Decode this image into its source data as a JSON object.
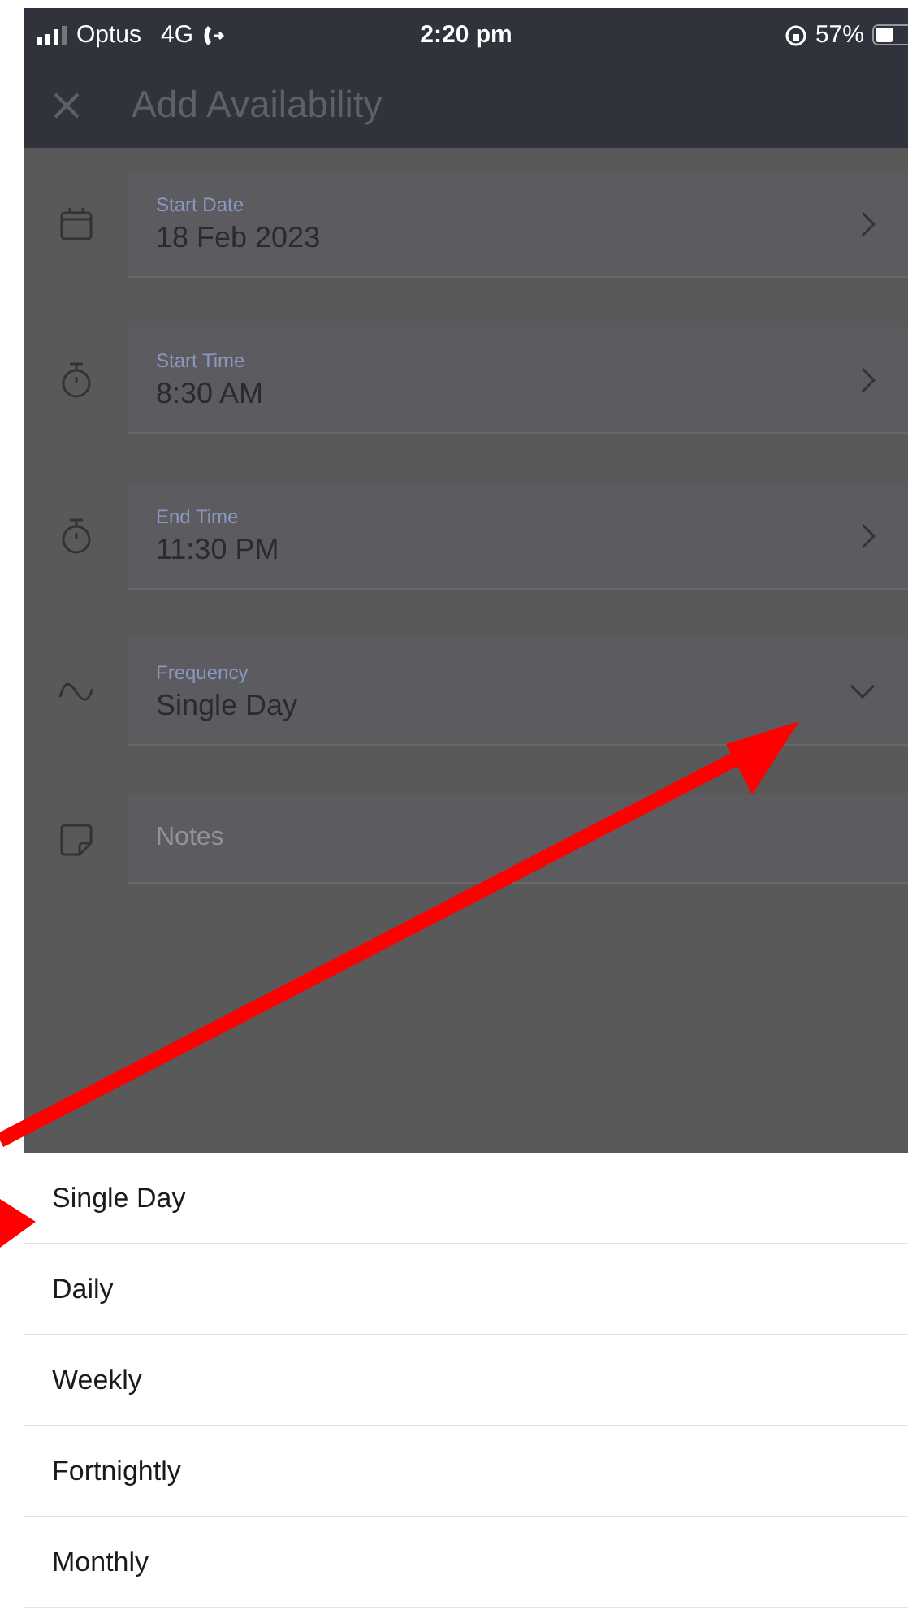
{
  "status_bar": {
    "carrier": "Optus",
    "network": "4G",
    "time": "2:20 pm",
    "battery": "57%"
  },
  "header": {
    "title": "Add Availability"
  },
  "fields": [
    {
      "kind": "picker",
      "label": "Start Date",
      "value": "18 Feb 2023"
    },
    {
      "kind": "picker",
      "label": "Start Time",
      "value": "8:30 AM"
    },
    {
      "kind": "picker",
      "label": "End Time",
      "value": "11:30 PM"
    },
    {
      "kind": "dropdown",
      "label": "Frequency",
      "value": "Single Day"
    },
    {
      "kind": "text",
      "placeholder": "Notes"
    }
  ],
  "sheet": {
    "options": [
      "Single Day",
      "Daily",
      "Weekly",
      "Fortnightly",
      "Monthly"
    ]
  }
}
